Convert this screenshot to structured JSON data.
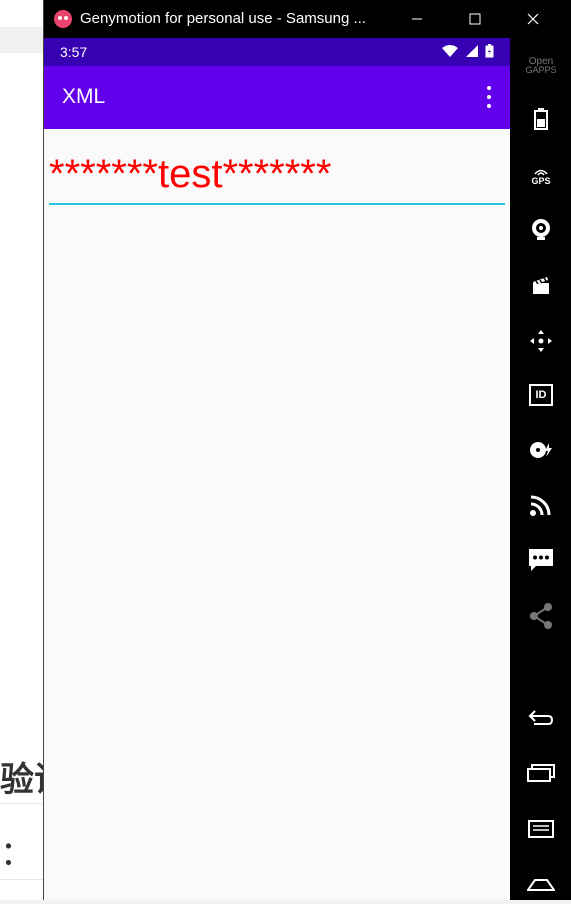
{
  "window": {
    "title": "Genymotion for personal use - Samsung ...",
    "buttons": {
      "minimize": "minimize",
      "maximize": "maximize",
      "close": "close"
    }
  },
  "status_bar": {
    "time": "3:57"
  },
  "app_bar": {
    "title": "XML"
  },
  "content": {
    "edit_text_value": "*******test*******"
  },
  "toolbar": {
    "open_gapps_line1": "Open",
    "open_gapps_line2": "GAPPS",
    "gps_label": "GPS",
    "id_label": "ID"
  },
  "background_page": {
    "text_line1": "验证",
    "text_line2": "："
  },
  "colors": {
    "status_bar": "#3700b3",
    "app_bar": "#6200ee",
    "edit_text": "#ff0000",
    "underline": "#26c6da"
  }
}
